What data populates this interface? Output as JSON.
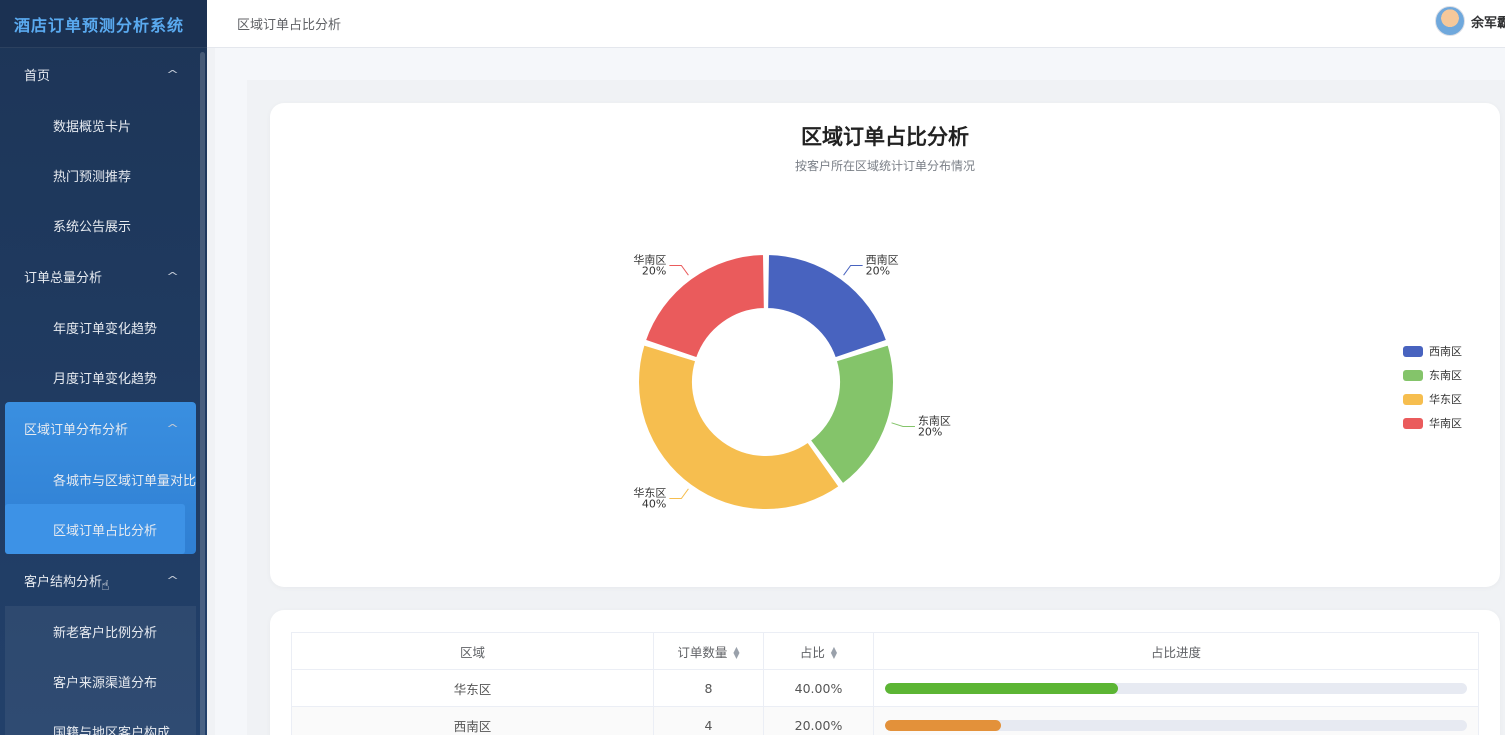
{
  "app": {
    "title": "酒店订单预测分析系统"
  },
  "header": {
    "breadcrumb": "区域订单占比分析",
    "user_name": "余军霸"
  },
  "sidebar": {
    "groups": [
      {
        "label": "首页",
        "items": [
          "数据概览卡片",
          "热门预测推荐",
          "系统公告展示"
        ]
      },
      {
        "label": "订单总量分析",
        "items": [
          "年度订单变化趋势",
          "月度订单变化趋势"
        ]
      },
      {
        "label": "区域订单分布分析",
        "items": [
          "各城市与区域订单量对比",
          "区域订单占比分析"
        ]
      },
      {
        "label": "客户结构分析",
        "items": [
          "新老客户比例分析",
          "客户来源渠道分布",
          "国籍与地区客户构成"
        ]
      }
    ],
    "selected_item": "区域订单占比分析"
  },
  "chart_data": {
    "type": "pie",
    "title": "区域订单占比分析",
    "subtitle": "按客户所在区域统计订单分布情况",
    "donut": true,
    "legend_position": "right",
    "slices": [
      {
        "name": "西南区",
        "value": 4,
        "percent": "20%",
        "color": "#4863bf"
      },
      {
        "name": "东南区",
        "value": 4,
        "percent": "20%",
        "color": "#84c46a"
      },
      {
        "name": "华东区",
        "value": 8,
        "percent": "40%",
        "color": "#f6be4f"
      },
      {
        "name": "华南区",
        "value": 4,
        "percent": "20%",
        "color": "#ea5b5c"
      }
    ]
  },
  "table": {
    "headers": [
      "区域",
      "订单数量",
      "占比",
      "占比进度"
    ],
    "rows": [
      {
        "region": "华东区",
        "count": "8",
        "ratio": "40.00%",
        "progress": 0.4,
        "bar_color": "#5cb534"
      },
      {
        "region": "西南区",
        "count": "4",
        "ratio": "20.00%",
        "progress": 0.2,
        "bar_color": "#e3913a"
      }
    ]
  }
}
